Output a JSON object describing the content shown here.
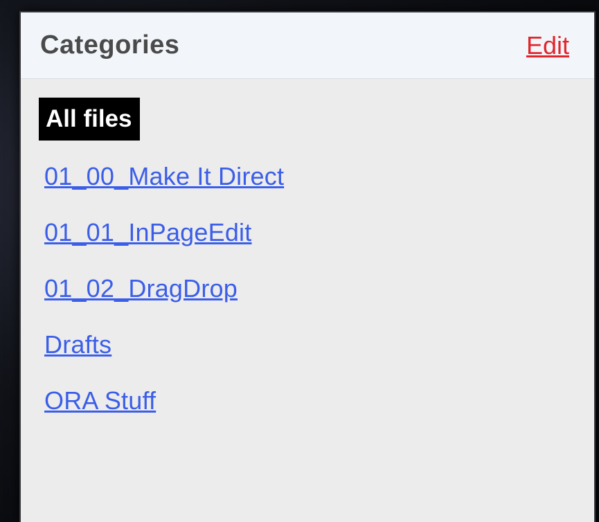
{
  "panel": {
    "title": "Categories",
    "edit_label": "Edit"
  },
  "categories": {
    "selected": "All files",
    "items": [
      {
        "label": "01_00_Make It Direct"
      },
      {
        "label": "01_01_InPageEdit"
      },
      {
        "label": "01_02_DragDrop"
      },
      {
        "label": "Drafts"
      },
      {
        "label": "ORA Stuff"
      }
    ]
  },
  "colors": {
    "link": "#3b5ee8",
    "edit": "#e0262b",
    "selected_bg": "#000000",
    "panel_bg": "#ececec",
    "header_bg": "#f2f6fb"
  }
}
